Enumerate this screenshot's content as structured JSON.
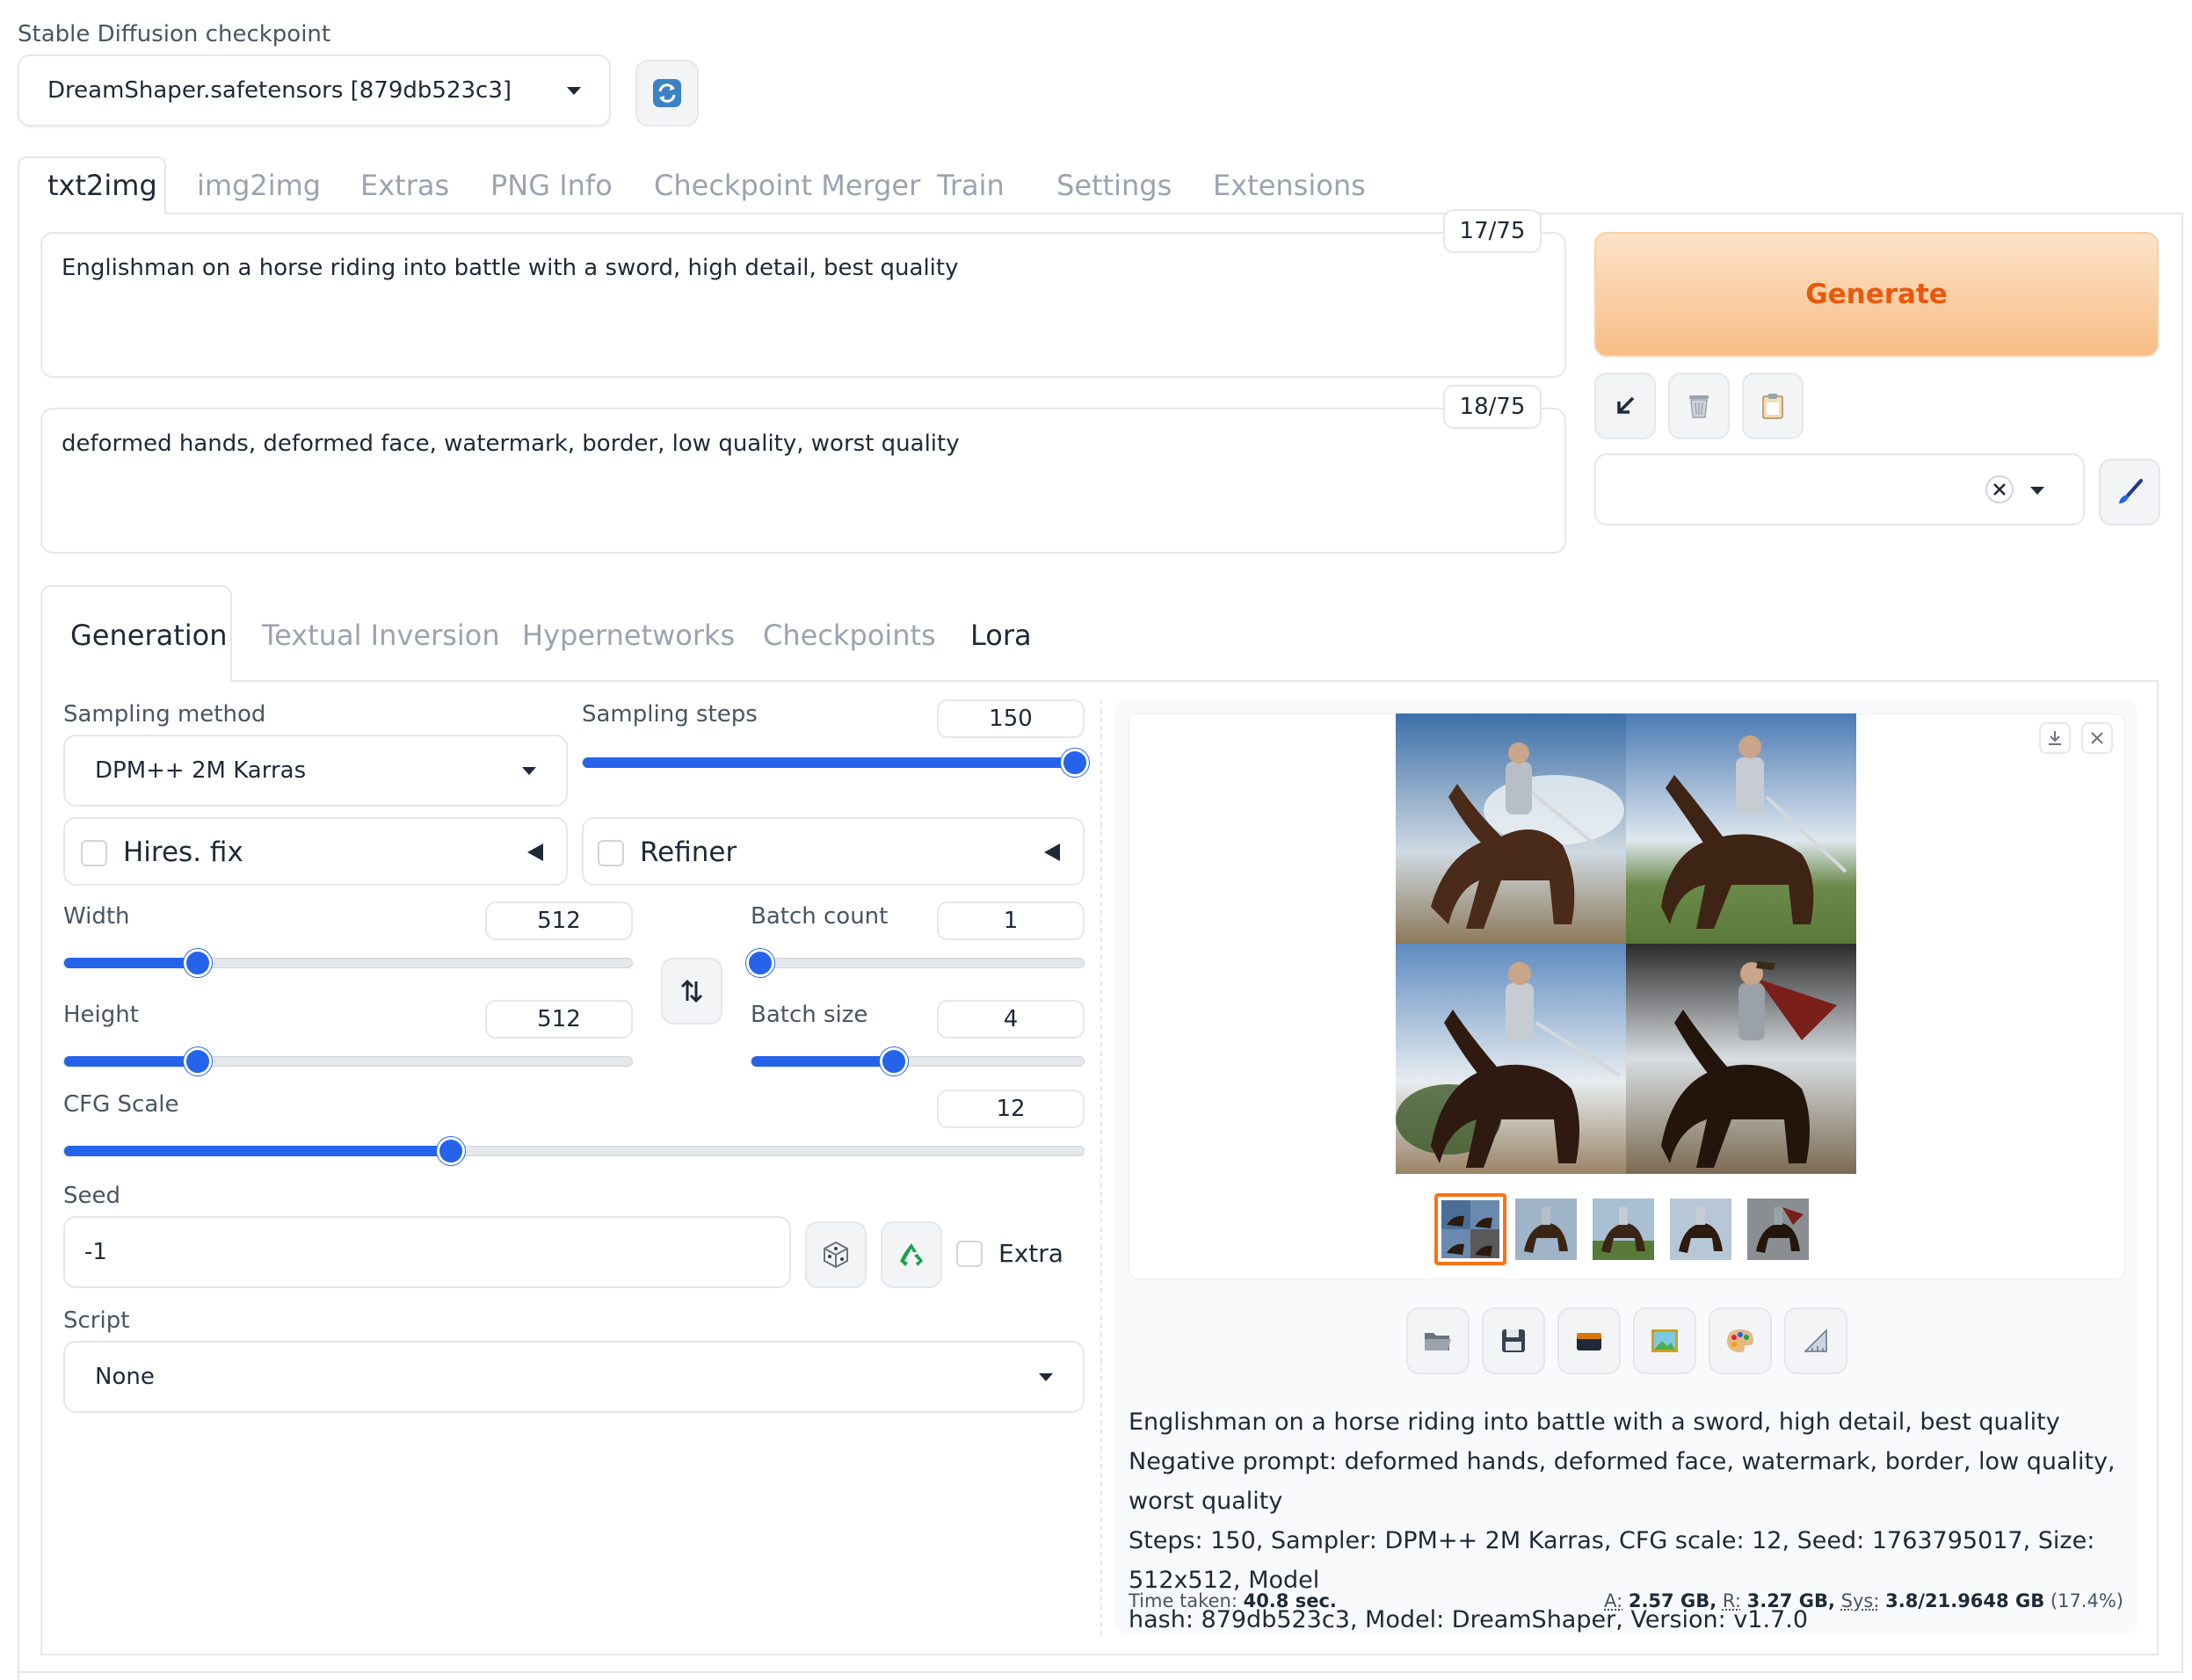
{
  "checkpoint": {
    "label": "Stable Diffusion checkpoint",
    "value": "DreamShaper.safetensors [879db523c3]"
  },
  "main_tabs": [
    {
      "label": "txt2img",
      "active": true
    },
    {
      "label": "img2img"
    },
    {
      "label": "Extras"
    },
    {
      "label": "PNG Info"
    },
    {
      "label": "Checkpoint Merger"
    },
    {
      "label": "Train"
    },
    {
      "label": "Settings"
    },
    {
      "label": "Extensions"
    }
  ],
  "prompt": {
    "text": "Englishman on a horse riding into battle with a sword, high detail, best quality",
    "token_count": "17/75"
  },
  "negative_prompt": {
    "text": "deformed hands, deformed face, watermark, border, low quality, worst quality",
    "token_count": "18/75"
  },
  "generate_label": "Generate",
  "sub_tabs": [
    {
      "label": "Generation",
      "active": true
    },
    {
      "label": "Textual Inversion"
    },
    {
      "label": "Hypernetworks"
    },
    {
      "label": "Checkpoints"
    },
    {
      "label": "Lora"
    }
  ],
  "sampling_method": {
    "label": "Sampling method",
    "value": "DPM++ 2M Karras"
  },
  "sampling_steps": {
    "label": "Sampling steps",
    "value": "150",
    "fraction": 1.0
  },
  "hires_fix": {
    "label": "Hires. fix",
    "checked": false
  },
  "refiner": {
    "label": "Refiner",
    "checked": false
  },
  "width": {
    "label": "Width",
    "value": "512",
    "fraction": 0.2353
  },
  "height": {
    "label": "Height",
    "value": "512",
    "fraction": 0.2353
  },
  "batch_count": {
    "label": "Batch count",
    "value": "1",
    "fraction": 0.0
  },
  "batch_size": {
    "label": "Batch size",
    "value": "4",
    "fraction": 0.4286
  },
  "cfg_scale": {
    "label": "CFG Scale",
    "value": "12",
    "fraction": 0.3793
  },
  "seed": {
    "label": "Seed",
    "value": "-1",
    "extra_label": "Extra",
    "extra_checked": false
  },
  "script": {
    "label": "Script",
    "value": "None"
  },
  "output": {
    "info_prompt": "Englishman on a horse riding into battle with a sword, high detail, best quality",
    "info_negative": "Negative prompt: deformed hands, deformed face, watermark, border, low quality, worst quality",
    "info_params_1": "Steps: 150, Sampler: DPM++ 2M Karras, CFG scale: 12, Seed: 1763795017, Size: 512x512, Model",
    "info_params_2": "hash: 879db523c3, Model: DreamShaper, Version: v1.7.0",
    "time_label": "Time taken:",
    "time_value": "40.8 sec.",
    "mem_a_label": "A:",
    "mem_a_value": "2.57 GB,",
    "mem_r_label": "R:",
    "mem_r_value": "3.27 GB,",
    "mem_sys_label": "Sys:",
    "mem_sys_value": "3.8/21.9648 GB",
    "mem_sys_pct": "(17.4%)"
  },
  "colors": {
    "accent": "#2563eb",
    "generate_text": "#ea580c",
    "generate_bg_top": "#fde3c8",
    "generate_bg_bottom": "#f7bd86",
    "thumb_selected": "#f97316"
  },
  "icons": {
    "refresh": "refresh-icon",
    "arrow": "arrow-down-left-icon",
    "trash": "trash-icon",
    "clipboard": "clipboard-icon",
    "brush": "brush-icon",
    "swap": "swap-icon",
    "dice": "dice-icon",
    "recycle": "recycle-icon",
    "folder": "folder-icon",
    "save": "save-icon",
    "zip": "zip-icon",
    "img2img": "image-icon",
    "inpaint": "palette-icon",
    "extras": "ruler-icon",
    "download": "download-icon",
    "close": "close-icon"
  }
}
